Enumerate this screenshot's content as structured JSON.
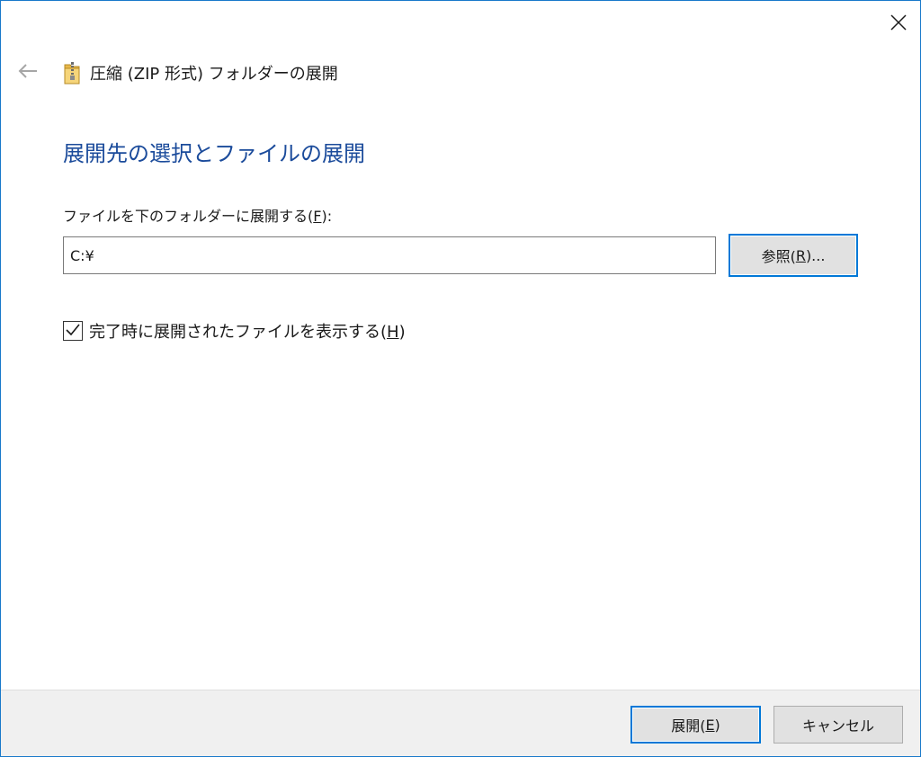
{
  "dialog": {
    "title": "圧縮 (ZIP 形式) フォルダーの展開",
    "heading": "展開先の選択とファイルの展開",
    "destination": {
      "label_before": "ファイルを下のフォルダーに展開する(",
      "label_key": "F",
      "label_after": "):",
      "path_value": "C:¥"
    },
    "browse_button": {
      "before": "参照(",
      "key": "R",
      "after": ")..."
    },
    "show_files": {
      "checked": true,
      "label_before": "完了時に展開されたファイルを表示する(",
      "label_key": "H",
      "label_after": ")"
    }
  },
  "footer": {
    "extract_button": {
      "before": "展開(",
      "key": "E",
      "after": ")"
    },
    "cancel_label": "キャンセル"
  },
  "icons": {
    "close": "close-icon",
    "back": "back-arrow-icon",
    "zip_folder": "zip-folder-icon",
    "checkmark": "checkmark-icon"
  },
  "colors": {
    "accent": "#0078d7",
    "heading": "#1b4b9b",
    "window_border": "#1979ca",
    "footer_bg": "#f0f0f0",
    "button_bg": "#e1e1e1"
  }
}
